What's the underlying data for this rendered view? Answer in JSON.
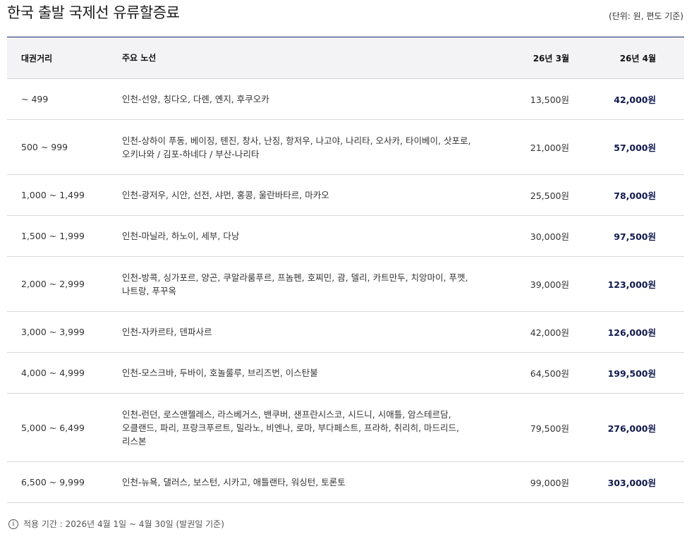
{
  "title": "한국 출발 국제선 유류할증료",
  "unit_note": "(단위: 원, 편도 기준)",
  "table": {
    "headers": [
      "대권거리",
      "주요 노선",
      "26년 3월",
      "26년 4월"
    ],
    "rows": [
      {
        "distance": "~ 499",
        "routes": [
          "인천-선양, 칭다오, 다롄, 옌지, 후쿠오카"
        ],
        "march": "13,500원",
        "april": "42,000원"
      },
      {
        "distance": "500 ~ 999",
        "routes": [
          "인천-상하이 푸동, 베이징, 톈진, 창사, 난징, 항저우, 나고야, 나리타, 오사카, 타이베이, 삿포로,",
          "오키나와 / 김포-하네다 / 부산-나리타"
        ],
        "march": "21,000원",
        "april": "57,000원"
      },
      {
        "distance": "1,000 ~ 1,499",
        "routes": [
          "인천-광저우, 시안, 선전, 샤먼, 홍콩, 울란바타르, 마카오"
        ],
        "march": "25,500원",
        "april": "78,000원"
      },
      {
        "distance": "1,500 ~ 1,999",
        "routes": [
          "인천-마닐라, 하노이, 세부, 다낭"
        ],
        "march": "30,000원",
        "april": "97,500원"
      },
      {
        "distance": "2,000 ~ 2,999",
        "routes": [
          "인천-방콕, 싱가포르, 양곤, 쿠알라룸푸르, 프놈펜, 호찌민, 괌, 델리, 카트만두, 치앙마이, 푸껫,",
          "나트랑, 푸꾸옥"
        ],
        "march": "39,000원",
        "april": "123,000원"
      },
      {
        "distance": "3,000 ~ 3,999",
        "routes": [
          "인천-자카르타, 덴파사르"
        ],
        "march": "42,000원",
        "april": "126,000원"
      },
      {
        "distance": "4,000 ~ 4,999",
        "routes": [
          "인천-모스크바, 두바이, 호놀룰루, 브리즈번, 이스탄불"
        ],
        "march": "64,500원",
        "april": "199,500원"
      },
      {
        "distance": "5,000 ~ 6,499",
        "routes": [
          "인천-런던, 로스앤젤레스, 라스베거스, 밴쿠버, 샌프란시스코, 시드니, 시애틀, 암스테르담,",
          "오클랜드, 파리, 프랑크푸르트, 밀라노, 비엔나, 로마, 부다페스트, 프라하, 취리히, 마드리드,",
          "리스본"
        ],
        "march": "79,500원",
        "april": "276,000원"
      },
      {
        "distance": "6,500 ~ 9,999",
        "routes": [
          "인천-뉴욕, 댈러스, 보스턴, 시카고, 애틀랜타, 워싱턴, 토론토"
        ],
        "march": "99,000원",
        "april": "303,000원"
      }
    ]
  },
  "footnote": {
    "icon": "info-icon",
    "text": "적용 기간 : 2026년 4월 1일 ~ 4월 30일 (발권일 기준)"
  }
}
